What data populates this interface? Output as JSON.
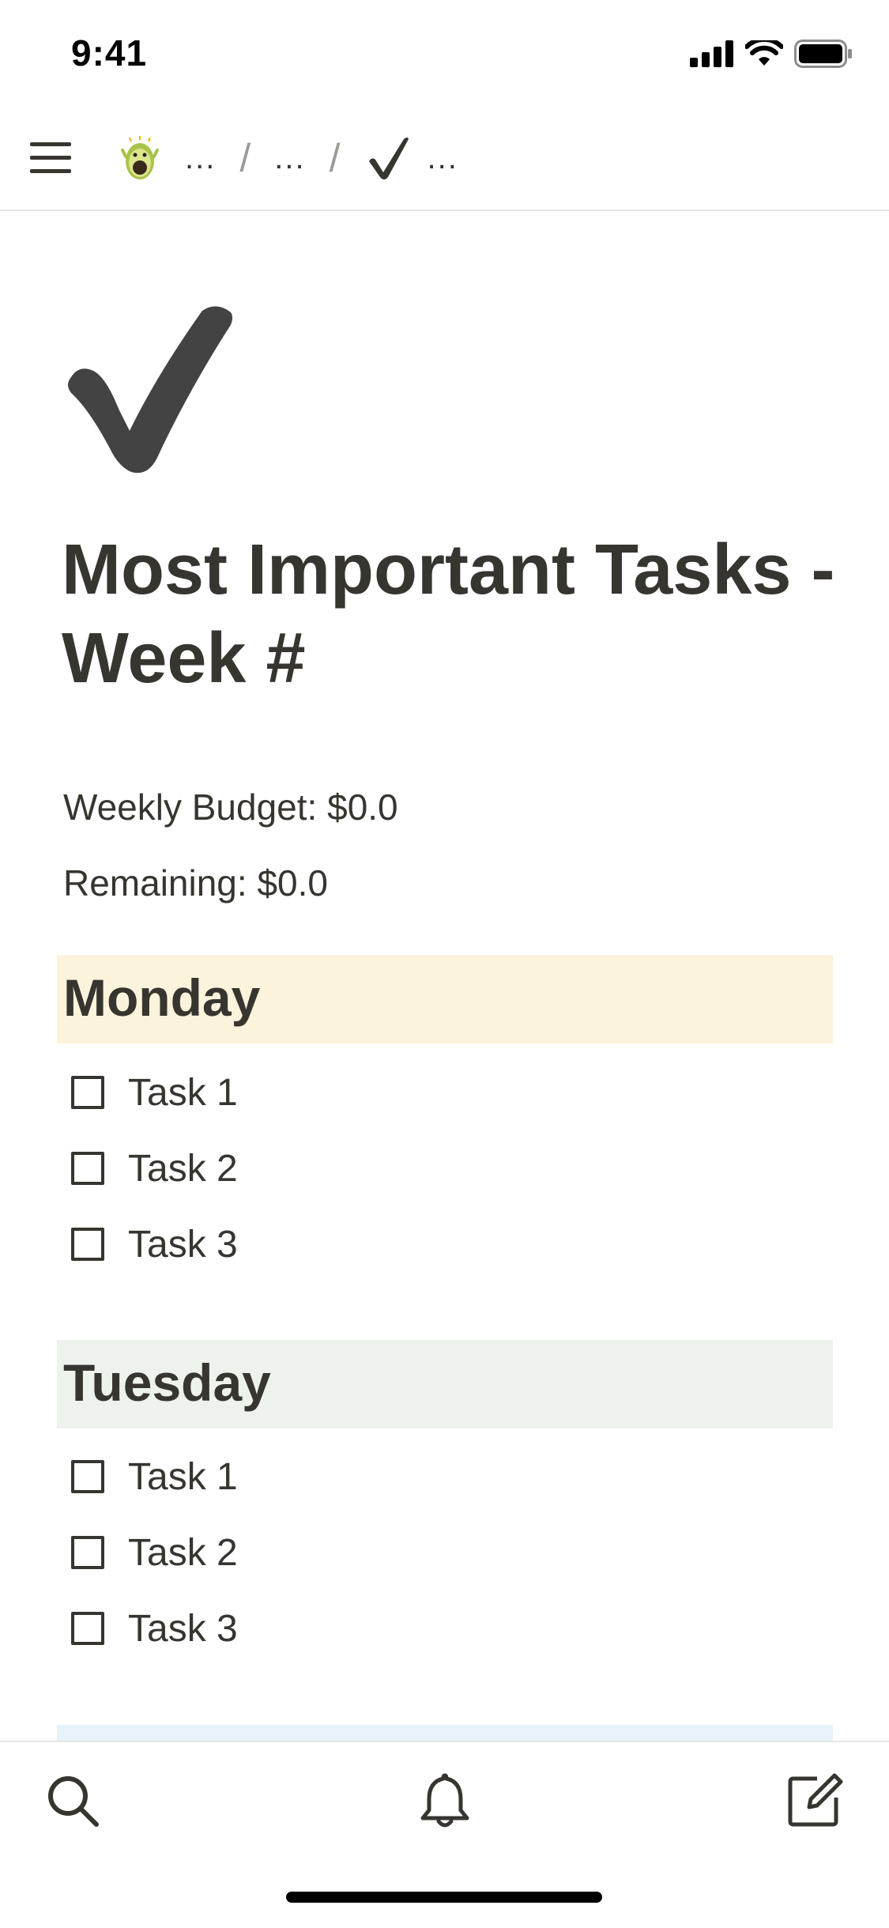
{
  "status_bar": {
    "time": "9:41"
  },
  "nav": {
    "breadcrumbs": [
      "...",
      "...",
      "..."
    ],
    "separator": "/"
  },
  "page": {
    "title": "Most Important Tasks - Week #",
    "weekly_budget": "Weekly Budget: $0.0",
    "remaining": "Remaining: $0.0"
  },
  "days": [
    {
      "name": "Monday",
      "color": "#fbf3db",
      "tasks": [
        {
          "label": "Task 1",
          "checked": false
        },
        {
          "label": "Task 2",
          "checked": false
        },
        {
          "label": "Task 3",
          "checked": false
        }
      ]
    },
    {
      "name": "Tuesday",
      "color": "#edf3ec",
      "tasks": [
        {
          "label": "Task 1",
          "checked": false
        },
        {
          "label": "Task 2",
          "checked": false
        },
        {
          "label": "Task 3",
          "checked": false
        }
      ]
    }
  ],
  "icons": {
    "menu": "hamburger-menu-icon",
    "workspace": "avocado-avatar-icon",
    "page": "checkmark-icon",
    "search": "search-icon",
    "notifications": "bell-icon",
    "new_page": "compose-icon"
  }
}
